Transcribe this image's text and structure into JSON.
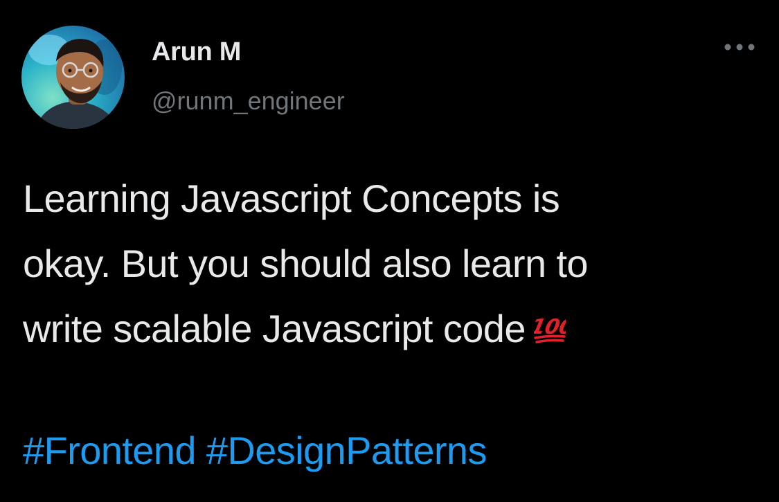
{
  "author": {
    "display_name": "Arun M",
    "handle": "@runm_engineer",
    "avatar_icon": "avatar-photo"
  },
  "more_icon": "ellipsis-icon",
  "tweet": {
    "lines": [
      "Learning Javascript Concepts is",
      "okay. But you should also learn to",
      "write scalable Javascript code"
    ],
    "emoji": "💯",
    "hashtags": [
      "#Frontend",
      "#DesignPatterns"
    ]
  },
  "colors": {
    "background": "#000000",
    "text": "#e7e9ea",
    "secondary": "#71767b",
    "link": "#1d9bf0",
    "emoji_red": "#e0202a"
  }
}
